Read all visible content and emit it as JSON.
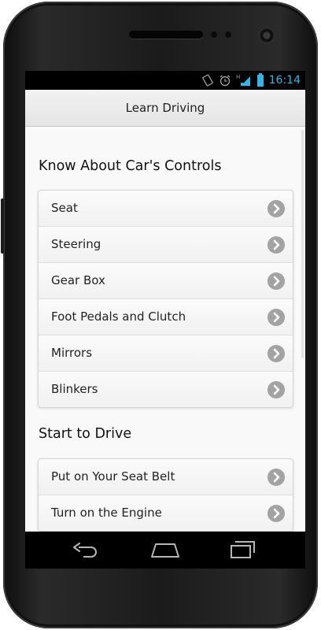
{
  "status_bar": {
    "time": "16:14",
    "icons": [
      "screen-rotation-icon",
      "alarm-icon",
      "hspa-signal-icon",
      "battery-icon"
    ],
    "network_label": "H",
    "accent_color": "#33b5e5"
  },
  "app_bar": {
    "title": "Learn Driving"
  },
  "sections": [
    {
      "title": "Know About Car's Controls",
      "items": [
        "Seat",
        "Steering",
        "Gear Box",
        "Foot Pedals and Clutch",
        "Mirrors",
        "Blinkers"
      ]
    },
    {
      "title": "Start to Drive",
      "items": [
        "Put on Your Seat Belt",
        "Turn on the Engine"
      ]
    }
  ],
  "nav_bar": {
    "icons": [
      "back-icon",
      "home-icon",
      "recent-apps-icon"
    ]
  }
}
